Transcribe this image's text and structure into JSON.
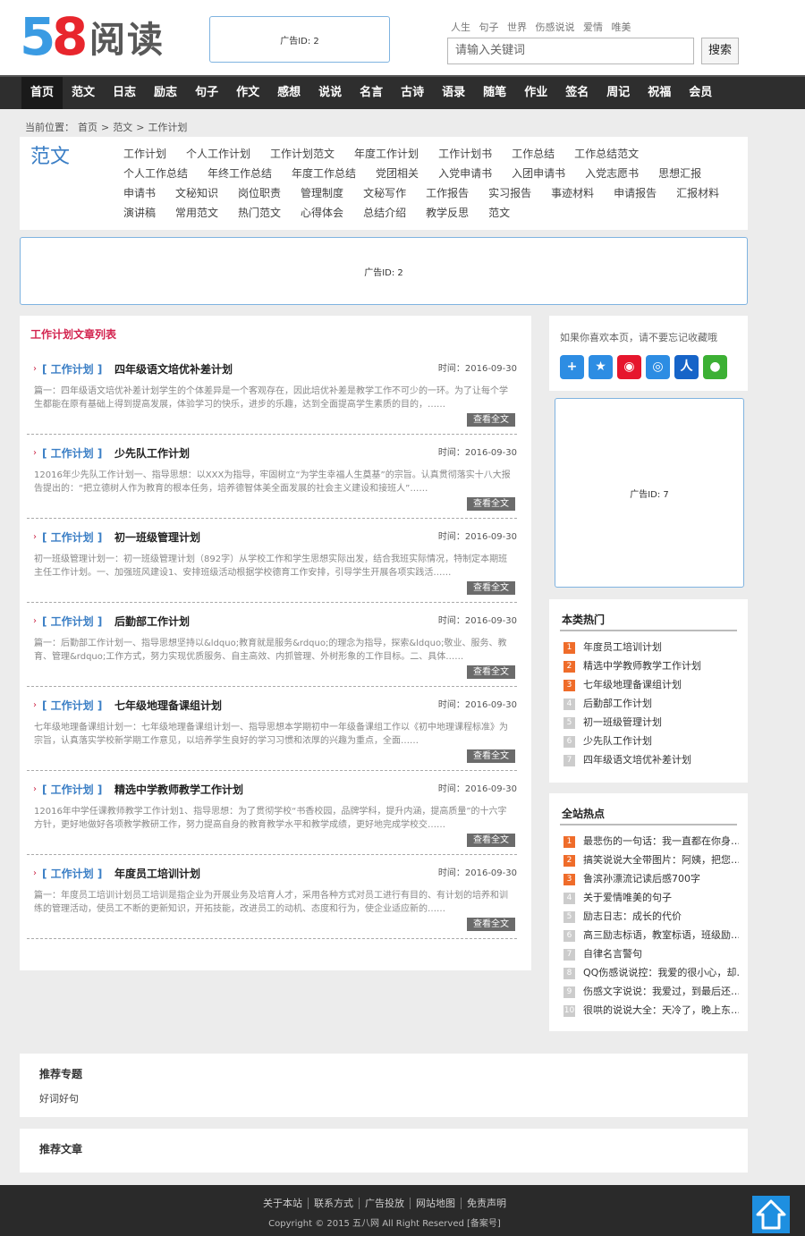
{
  "header": {
    "logo_number_5": "5",
    "logo_number_8": "8",
    "logo_text": "阅读",
    "ad_label": "广告ID: 2",
    "hot_links": [
      "人生",
      "句子",
      "世界",
      "伤感说说",
      "爱情",
      "唯美"
    ],
    "search_placeholder": "请输入关键词",
    "search_button": "搜索"
  },
  "nav": {
    "items": [
      "首页",
      "范文",
      "日志",
      "励志",
      "句子",
      "作文",
      "感想",
      "说说",
      "名言",
      "古诗",
      "语录",
      "随笔",
      "作业",
      "签名",
      "周记",
      "祝福",
      "会员"
    ],
    "active_index": 0
  },
  "breadcrumb": {
    "prefix": "当前位置：",
    "items": [
      "首页",
      ">",
      "范文",
      ">",
      "工作计划"
    ]
  },
  "category": {
    "title": "范文",
    "links": [
      "工作计划",
      "个人工作计划",
      "工作计划范文",
      "年度工作计划",
      "工作计划书",
      "工作总结",
      "工作总结范文",
      "个人工作总结",
      "年终工作总结",
      "年度工作总结",
      "党团相关",
      "入党申请书",
      "入团申请书",
      "入党志愿书",
      "思想汇报",
      "申请书",
      "文秘知识",
      "岗位职责",
      "管理制度",
      "文秘写作",
      "工作报告",
      "实习报告",
      "事迹材料",
      "申请报告",
      "汇报材料",
      "演讲稿",
      "常用范文",
      "热门范文",
      "心得体会",
      "总结介绍",
      "教学反思",
      "范文"
    ]
  },
  "ad_mid_label": "广告ID: 2",
  "main": {
    "title": "工作计划文章列表",
    "articles": [
      {
        "tag": "[ 工作计划 ]",
        "title": "四年级语文培优补差计划",
        "time": "时间：2016-09-30",
        "summary": "篇一：四年级语文培优补差计划学生的个体差异是一个客观存在，因此培优补差是教学工作不可少的一环。为了让每个学生都能在原有基础上得到提高发展，体验学习的快乐，进步的乐趣，达到全面提高学生素质的目的，……",
        "more": "查看全文"
      },
      {
        "tag": "[ 工作计划 ]",
        "title": "少先队工作计划",
        "time": "时间：2016-09-30",
        "summary": "12016年少先队工作计划一、指导思想：以XXX为指导，牢固树立“为学生幸福人生奠基”的宗旨。认真贯彻落实十八大报告提出的：“把立德树人作为教育的根本任务，培养德智体美全面发展的社会主义建设和接班人”……",
        "more": "查看全文"
      },
      {
        "tag": "[ 工作计划 ]",
        "title": "初一班级管理计划",
        "time": "时间：2016-09-30",
        "summary": "初一班级管理计划一：初一班级管理计划（892字）从学校工作和学生思想实际出发，结合我班实际情况，特制定本期班主任工作计划。一、加强班风建设1、安排班级活动根据学校德育工作安排，引导学生开展各项实践活……",
        "more": "查看全文"
      },
      {
        "tag": "[ 工作计划 ]",
        "title": "后勤部工作计划",
        "time": "时间：2016-09-30",
        "summary": "篇一：后勤部工作计划一、指导思想坚持以&ldquo;教育就是服务&rdquo;的理念为指导，探索&ldquo;敬业、服务、教育、管理&rdquo;工作方式，努力实现优质服务、自主高效、内抓管理、外树形象的工作目标。二、具体……",
        "more": "查看全文"
      },
      {
        "tag": "[ 工作计划 ]",
        "title": "七年级地理备课组计划",
        "time": "时间：2016-09-30",
        "summary": "七年级地理备课组计划一：七年级地理备课组计划一、指导思想本学期初中一年级备课组工作以《初中地理课程标准》为宗旨，认真落实学校新学期工作意见，以培养学生良好的学习习惯和浓厚的兴趣为重点，全面……",
        "more": "查看全文"
      },
      {
        "tag": "[ 工作计划 ]",
        "title": "精选中学教师教学工作计划",
        "time": "时间：2016-09-30",
        "summary": "12016年中学任课教师教学工作计划1、指导思想：为了贯彻学校“书香校园，品牌学科，提升内涵，提高质量”的十六字方针，更好地做好各项教学教研工作，努力提高自身的教育教学水平和教学成绩，更好地完成学校交……",
        "more": "查看全文"
      },
      {
        "tag": "[ 工作计划 ]",
        "title": "年度员工培训计划",
        "time": "时间：2016-09-30",
        "summary": "篇一：年度员工培训计划员工培训是指企业为开展业务及培育人才，采用各种方式对员工进行有目的、有计划的培养和训练的管理活动，使员工不断的更新知识，开拓技能，改进员工的动机、态度和行为，使企业适应新的……",
        "more": "查看全文"
      }
    ]
  },
  "sidebar": {
    "share_text": "如果你喜欢本页，请不要忘记收藏哦",
    "share_icons": [
      "plus-share-icon",
      "qzone-icon",
      "weibo-icon",
      "tencent-weibo-icon",
      "renren-icon",
      "wechat-icon"
    ],
    "ad_label": "广告ID: 7",
    "category_hot": {
      "title": "本类热门",
      "items": [
        "年度员工培训计划",
        "精选中学教师教学工作计划",
        "七年级地理备课组计划",
        "后勤部工作计划",
        "初一班级管理计划",
        "少先队工作计划",
        "四年级语文培优补差计划"
      ]
    },
    "site_hot": {
      "title": "全站热点",
      "items": [
        "最悲伤的一句话：我一直都在你身…",
        "搞笑说说大全带图片：阿姨，把您…",
        "鲁滨孙漂流记读后感700字",
        "关于爱情唯美的句子",
        "励志日志：成长的代价",
        "高三励志标语，教室标语，班级励…",
        "自律名言警句",
        "QQ伤感说说控：我爱的很小心，却…",
        "伤感文字说说：我爱过，到最后还…",
        "很哄的说说大全：天冷了，晚上东…"
      ]
    }
  },
  "recommend": {
    "topics_title": "推荐专题",
    "topics_link": "好词好句",
    "articles_title": "推荐文章"
  },
  "footer": {
    "links": [
      "关于本站",
      "联系方式",
      "广告投放",
      "网站地图",
      "免责声明"
    ],
    "copyright": "Copyright © 2015 五八网 All Right Reserved [备案号]"
  },
  "colors": {
    "nav_bg": "#2e2e2e",
    "accent_blue": "#3a7ec5",
    "list_title_red": "#d3244f",
    "rank_hot": "#ef6c2a",
    "back_to_top": "#1e8fe0"
  }
}
